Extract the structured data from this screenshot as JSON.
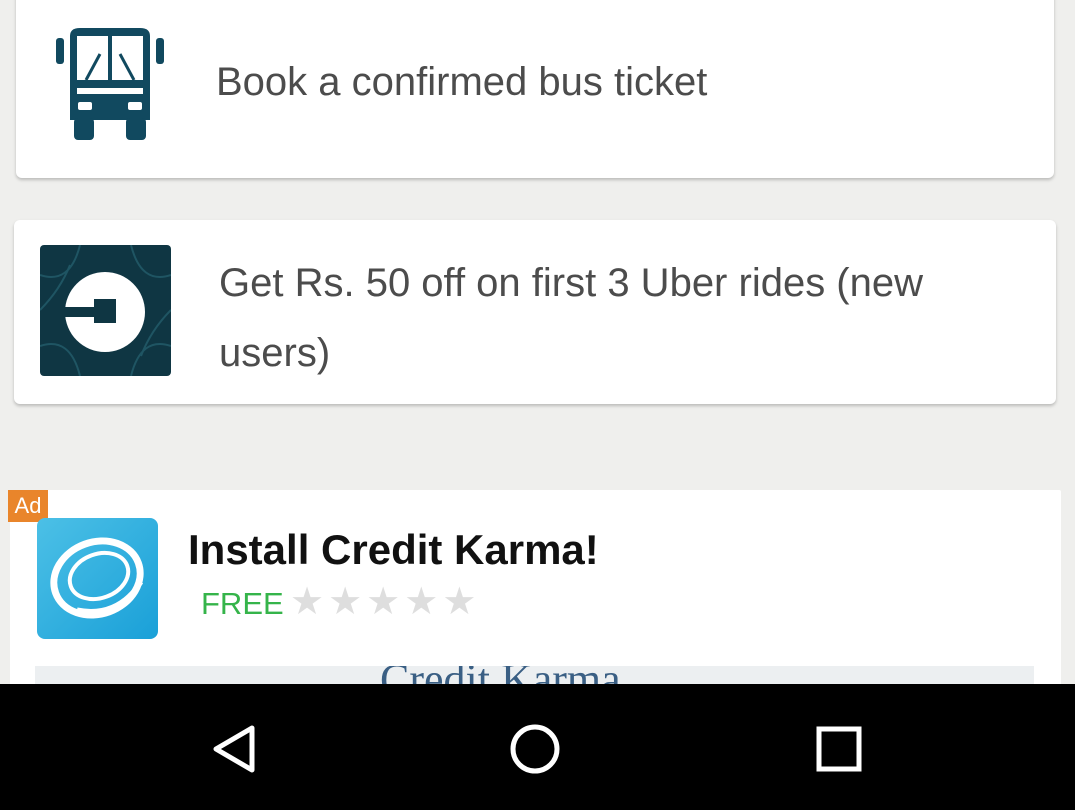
{
  "cards": {
    "bus": {
      "text": "Book a confirmed bus ticket",
      "icon": "bus-icon"
    },
    "uber": {
      "text": "Get Rs. 50 off on first 3 Uber rides (new users)",
      "icon": "uber-logo-icon"
    }
  },
  "ad": {
    "badge": "Ad",
    "title": "Install Credit Karma!",
    "price": "FREE",
    "rating_stars": 5,
    "rating_filled": 0,
    "banner_text": "Credit Karma",
    "icon": "credit-karma-logo-icon"
  },
  "navbar": {
    "back_icon": "back-triangle-icon",
    "home_icon": "home-circle-icon",
    "recents_icon": "recents-square-icon"
  },
  "colors": {
    "accent_teal": "#11495f",
    "uber_bg": "#0f3643",
    "ad_badge": "#e9852b",
    "free_green": "#35b44a",
    "background": "#efefed"
  }
}
